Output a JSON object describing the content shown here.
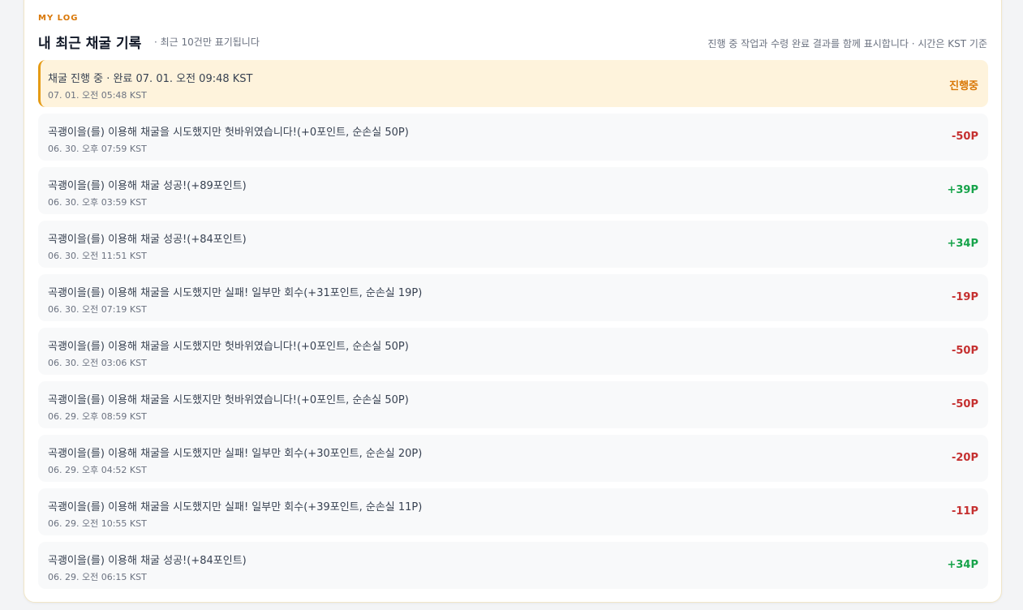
{
  "header": {
    "eyebrow": "MY LOG",
    "title": "내 최근 채굴 기록",
    "subtitle": "· 최근 10건만 표기됩니다",
    "note": "진행 중 작업과 수령 완료 결과를 함께 표시합니다 · 시간은 KST 기준"
  },
  "colors": {
    "accent": "#d97706",
    "negative": "#c53030",
    "positive": "#16a34a"
  },
  "logs": [
    {
      "text": "채굴 진행 중 · 완료 07. 01. 오전 09:48 KST",
      "time": "07. 01. 오전 05:48 KST",
      "value": "진행중",
      "status": "pending"
    },
    {
      "text": "곡괭이을(를) 이용해 채굴을 시도했지만 헛바위였습니다!(+0포인트, 순손실 50P)",
      "time": "06. 30. 오후 07:59 KST",
      "value": "-50P",
      "status": "neg"
    },
    {
      "text": "곡괭이을(를) 이용해 채굴 성공!(+89포인트)",
      "time": "06. 30. 오후 03:59 KST",
      "value": "+39P",
      "status": "pos"
    },
    {
      "text": "곡괭이을(를) 이용해 채굴 성공!(+84포인트)",
      "time": "06. 30. 오전 11:51 KST",
      "value": "+34P",
      "status": "pos"
    },
    {
      "text": "곡괭이을(를) 이용해 채굴을 시도했지만 실패! 일부만 회수(+31포인트, 순손실 19P)",
      "time": "06. 30. 오전 07:19 KST",
      "value": "-19P",
      "status": "neg"
    },
    {
      "text": "곡괭이을(를) 이용해 채굴을 시도했지만 헛바위였습니다!(+0포인트, 순손실 50P)",
      "time": "06. 30. 오전 03:06 KST",
      "value": "-50P",
      "status": "neg"
    },
    {
      "text": "곡괭이을(를) 이용해 채굴을 시도했지만 헛바위였습니다!(+0포인트, 순손실 50P)",
      "time": "06. 29. 오후 08:59 KST",
      "value": "-50P",
      "status": "neg"
    },
    {
      "text": "곡괭이을(를) 이용해 채굴을 시도했지만 실패! 일부만 회수(+30포인트, 순손실 20P)",
      "time": "06. 29. 오후 04:52 KST",
      "value": "-20P",
      "status": "neg"
    },
    {
      "text": "곡괭이을(를) 이용해 채굴을 시도했지만 실패! 일부만 회수(+39포인트, 순손실 11P)",
      "time": "06. 29. 오전 10:55 KST",
      "value": "-11P",
      "status": "neg"
    },
    {
      "text": "곡괭이을(를) 이용해 채굴 성공!(+84포인트)",
      "time": "06. 29. 오전 06:15 KST",
      "value": "+34P",
      "status": "pos"
    }
  ]
}
